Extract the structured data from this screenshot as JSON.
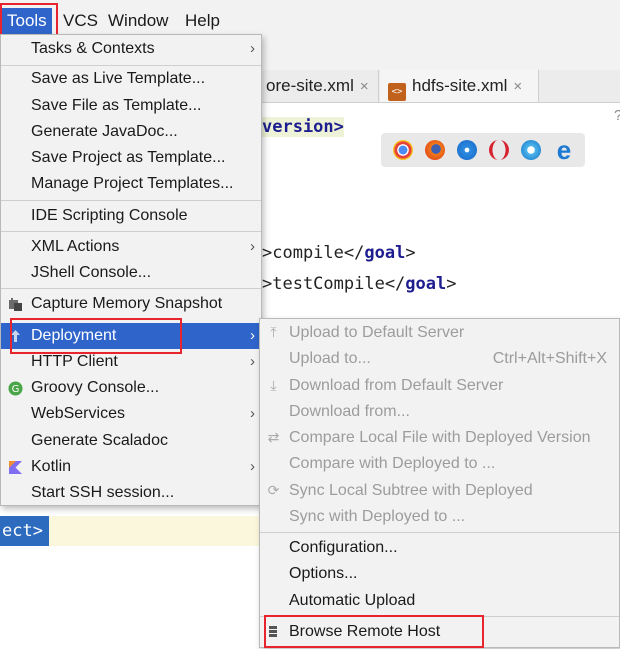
{
  "menubar": {
    "tools": "Tools",
    "vcs": "VCS",
    "window": "Window",
    "help": "Help"
  },
  "editor": {
    "tabs": [
      {
        "label": "ore-site.xml"
      },
      {
        "label": "hdfs-site.xml"
      }
    ],
    "file_icon_text": "<>",
    "close_glyph": "×",
    "code_lines": {
      "version": "version>",
      "compile_open": ">compile</",
      "compile_goal": "goal",
      "compile_close": ">",
      "testcompile_open": ">testCompile</",
      "testcompile_goal": "goal",
      "testcompile_close": ">",
      "ect": "ect>"
    },
    "gutter_char": "?",
    "browser_icons": [
      "chrome-icon",
      "firefox-icon",
      "safari-icon",
      "opera-icon",
      "ie-icon",
      "edge-icon"
    ]
  },
  "tools_menu": {
    "items": [
      {
        "label": "Tasks & Contexts",
        "submenu": true
      },
      {
        "label": "Save as Live Template..."
      },
      {
        "label": "Save File as Template..."
      },
      {
        "label": "Generate JavaDoc..."
      },
      {
        "label": "Save Project as Template..."
      },
      {
        "label": "Manage Project Templates..."
      },
      {
        "label": "IDE Scripting Console"
      },
      {
        "label": "XML Actions",
        "submenu": true
      },
      {
        "label": "JShell Console..."
      },
      {
        "label": "Capture Memory Snapshot"
      },
      {
        "label": "Deployment",
        "submenu": true,
        "active": true
      },
      {
        "label": "HTTP Client",
        "submenu": true
      },
      {
        "label": "Groovy Console..."
      },
      {
        "label": "WebServices",
        "submenu": true
      },
      {
        "label": "Generate Scaladoc"
      },
      {
        "label": "Kotlin",
        "submenu": true
      },
      {
        "label": "Start SSH session..."
      }
    ],
    "arrow_glyph": "›"
  },
  "deployment_menu": {
    "items": [
      {
        "label": "Upload to Default Server",
        "enabled": false
      },
      {
        "label": "Upload to...",
        "shortcut": "Ctrl+Alt+Shift+X",
        "enabled": false
      },
      {
        "label": "Download from Default Server",
        "enabled": false
      },
      {
        "label": "Download from...",
        "enabled": false
      },
      {
        "label": "Compare Local File with Deployed Version",
        "enabled": false
      },
      {
        "label": "Compare with Deployed to ...",
        "enabled": false
      },
      {
        "label": "Sync Local Subtree with Deployed",
        "enabled": false
      },
      {
        "label": "Sync with Deployed to ...",
        "enabled": false
      },
      {
        "label": "Configuration...",
        "enabled": true
      },
      {
        "label": "Options...",
        "enabled": true
      },
      {
        "label": "Automatic Upload",
        "enabled": true
      },
      {
        "label": "Browse Remote Host",
        "enabled": true
      }
    ]
  },
  "colors": {
    "highlight": "#2f65ca",
    "annotation_red": "#e8242f",
    "menu_bg": "#f2f2f2",
    "disabled_text": "#9c9c9c"
  }
}
